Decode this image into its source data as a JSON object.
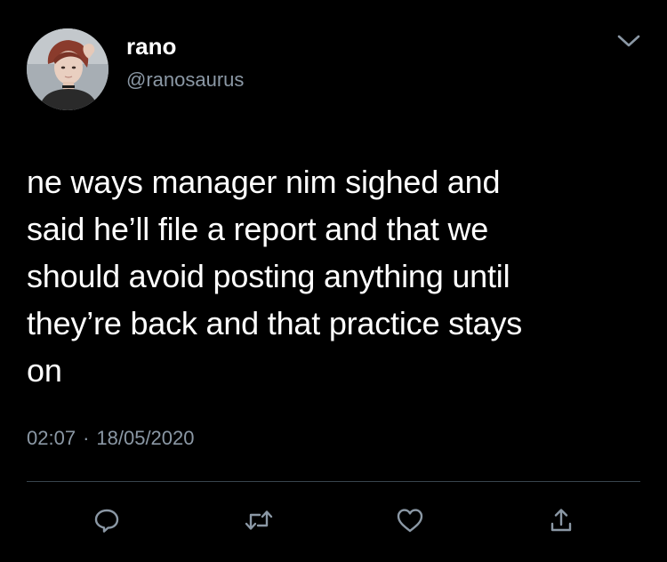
{
  "author": {
    "name": "rano",
    "handle": "@ranosaurus",
    "avatar_icon": "profile-photo"
  },
  "tweet": {
    "lines": [
      "ne ways manager nim sighed and",
      "said he’ll file a report and that we",
      "should avoid posting anything until",
      "they’re back and that practice stays",
      "on"
    ]
  },
  "meta": {
    "time": "02:07",
    "separator": "·",
    "date": "18/05/2020"
  },
  "actions": [
    {
      "name": "reply",
      "icon": "reply-icon"
    },
    {
      "name": "retweet",
      "icon": "retweet-icon"
    },
    {
      "name": "like",
      "icon": "heart-icon"
    },
    {
      "name": "share",
      "icon": "share-icon"
    }
  ],
  "colors": {
    "background": "#000000",
    "text": "#ffffff",
    "secondary": "#8b98a5",
    "divider": "#38444d"
  }
}
